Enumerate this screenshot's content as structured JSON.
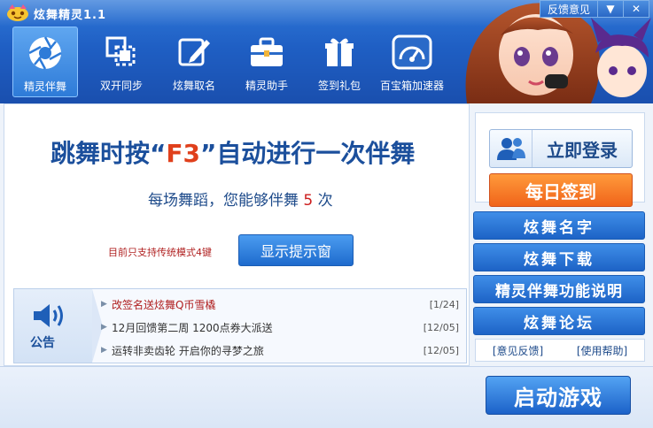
{
  "window": {
    "title": "炫舞精灵1.1",
    "feedback_label": "反馈意见",
    "menu_glyph": "▼",
    "close_glyph": "✕"
  },
  "nav": {
    "items": [
      {
        "label": "精灵伴舞",
        "icon": "aperture-icon"
      },
      {
        "label": "双开同步",
        "icon": "dual-window-icon"
      },
      {
        "label": "炫舞取名",
        "icon": "edit-pencil-icon"
      },
      {
        "label": "精灵助手",
        "icon": "briefcase-icon"
      },
      {
        "label": "签到礼包",
        "icon": "gift-icon"
      },
      {
        "label": "百宝箱加速器",
        "icon": "speedometer-icon"
      }
    ]
  },
  "main": {
    "headline_prefix": "跳舞时按“",
    "headline_key": "F3",
    "headline_suffix": "”自动进行一次伴舞",
    "sub_prefix": "每场舞蹈，您能够伴舞",
    "sub_count": "5",
    "sub_suffix": "次",
    "note": "目前只支持传统模式4键",
    "show_tip_button": "显示提示窗"
  },
  "announce": {
    "label": "公告",
    "items": [
      {
        "text": "改签名送炫舞Q币雪橇",
        "date": "[1/24]"
      },
      {
        "text": "12月回馈第二周 1200点券大派送",
        "date": "[12/05]"
      },
      {
        "text": "运转非卖齿轮 开启你的寻梦之旅",
        "date": "[12/05]"
      }
    ]
  },
  "sidebar": {
    "login_label": "立即登录",
    "signin_label": "每日签到",
    "buttons": [
      "炫舞名字",
      "炫舞下载",
      "精灵伴舞功能说明",
      "炫舞论坛"
    ],
    "feedback_link": "[意见反馈]",
    "help_link": "[使用帮助]"
  },
  "bottom": {
    "start_label": "启动游戏"
  },
  "colors": {
    "header_blue": "#1f5fc4",
    "accent_orange": "#f0641a",
    "hotkey_red": "#e0401c",
    "title_blue": "#1b4f9c"
  }
}
